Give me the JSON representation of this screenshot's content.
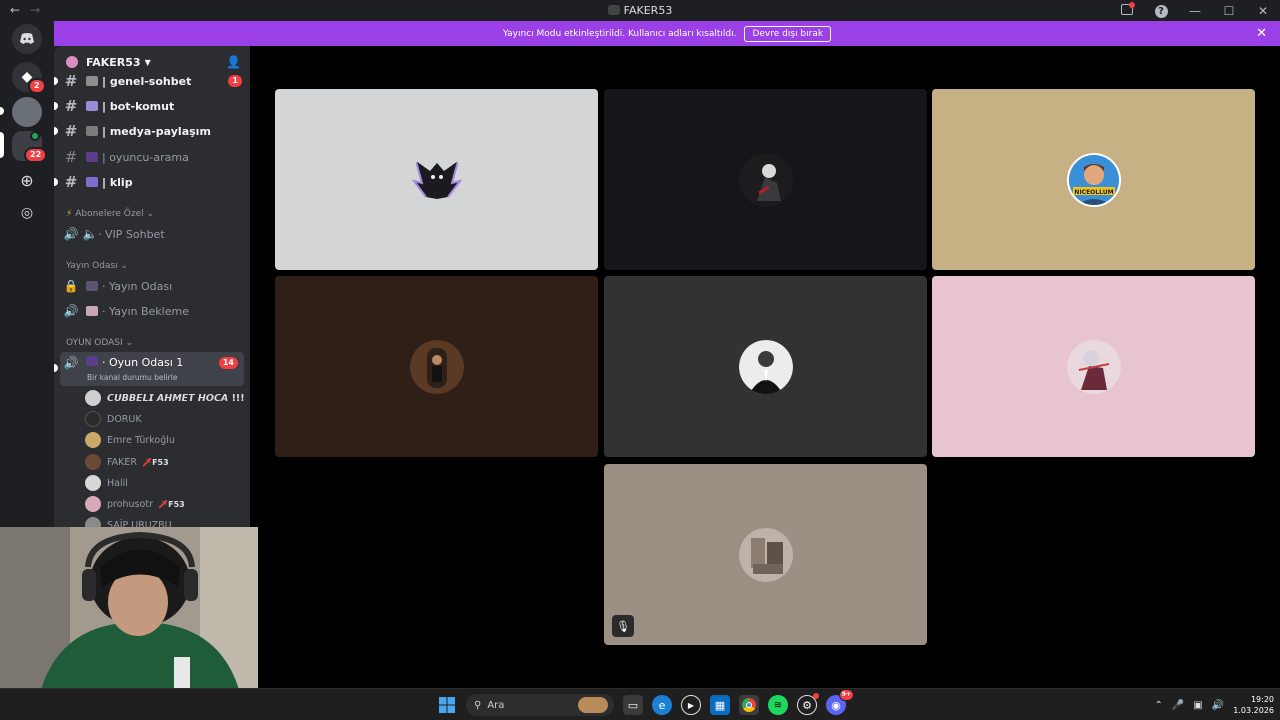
{
  "app": {
    "window_title": "FAKER53"
  },
  "banner": {
    "text": "Yayıncı Modu etkinleştirildi. Kullanıcı adları kısaltıldı.",
    "button_label": "Devre dışı bırak"
  },
  "rail": {
    "badges": [
      "2",
      "22"
    ]
  },
  "server": {
    "name": "FAKER53"
  },
  "channels": {
    "text": [
      {
        "name": "| genel-sohbet",
        "badge": "1"
      },
      {
        "name": "| bot-komut"
      },
      {
        "name": "| medya-paylaşım"
      },
      {
        "name": "| oyuncu-arama"
      },
      {
        "name": "| klip"
      }
    ],
    "categories": {
      "abone": "Abonelere Özel",
      "yayin": "Yayın Odası",
      "oyun": "OYUN ODASI"
    },
    "vip": "· VIP Sohbet",
    "yayin_odasi": "· Yayın Odası",
    "yayin_bekleme": "· Yayın Bekleme",
    "oyun_odasi": "· Oyun Odası 1",
    "oyun_odasi_count": "14",
    "status_hint": "Bir kanal durumu belirle"
  },
  "voice_users": [
    {
      "name": "𝘾𝙐𝘽𝘽𝙀𝙇𝙄 𝘼𝙃𝙈𝙀𝙏 𝙃𝙊𝘾𝘼 !!!",
      "tag": ""
    },
    {
      "name": "DORUK",
      "tag": ""
    },
    {
      "name": "Emre Türkoğlu",
      "tag": ""
    },
    {
      "name": "FAKER",
      "tag": "F53"
    },
    {
      "name": "Halil",
      "tag": ""
    },
    {
      "name": "prohusotr",
      "tag": "F53"
    },
    {
      "name": "SAİP URUZBU",
      "tag": ""
    }
  ],
  "stage": {
    "tiles": [
      {
        "bg": "#d4d5d7",
        "avatar": "#2a2a34"
      },
      {
        "bg": "#16161a",
        "avatar": "#3a3a3a"
      },
      {
        "bg": "#c6b184",
        "avatar": "#d08a4c",
        "label": "NICEOLLUM"
      },
      {
        "bg": "#2f1f17",
        "avatar": "#5a3a25"
      },
      {
        "bg": "#323232",
        "avatar": "#e8e8e8"
      },
      {
        "bg": "#e8c3d0",
        "avatar": "#b86a78"
      },
      {
        "bg": "#9c8f84",
        "avatar": "#7a6e64",
        "muted": true
      }
    ]
  },
  "taskbar": {
    "search_placeholder": "Ara",
    "time": "19:20",
    "date": "1.03.2026",
    "discord_badge": "9+"
  },
  "colors": {
    "banner": "#9b3fe7",
    "accent_green": "#23a55a",
    "badge_red": "#f23f43"
  }
}
